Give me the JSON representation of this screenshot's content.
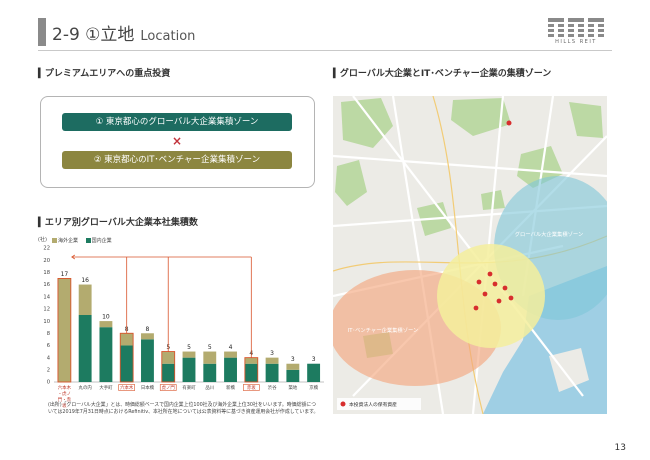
{
  "header": {
    "title": "2-9 ①立地",
    "title_en": "Location",
    "logo_text": "HILLS REIT"
  },
  "left": {
    "section_title": "プレミアムエリアへの重点投資",
    "zone_1": "① 東京都心のグローバル大企業集積ゾーン",
    "cross": "×",
    "zone_2": "② 東京都心のIT･ベンチャー企業集積ゾーン"
  },
  "chart_section_title": "エリア別グローバル大企業本社集積数",
  "chart_data": {
    "type": "bar",
    "unit": "(社)",
    "categories": [
      "六本木・虎ノ門・赤坂",
      "丸の内",
      "大手町",
      "六本木",
      "日本橋",
      "虎ノ門",
      "有楽町",
      "品川",
      "新橋",
      "赤坂",
      "渋谷",
      "築地",
      "京橋"
    ],
    "series": [
      {
        "name": "海外企業",
        "values": [
          17,
          5,
          1,
          2,
          1,
          2,
          1,
          2,
          1,
          1,
          1,
          1,
          0
        ],
        "color": "#b3ab6f"
      },
      {
        "name": "国内企業",
        "values": [
          0,
          11,
          9,
          6,
          7,
          3,
          4,
          3,
          4,
          3,
          3,
          2,
          3
        ],
        "color": "#1d7b60"
      }
    ],
    "totals": [
      17,
      16,
      10,
      8,
      8,
      5,
      5,
      5,
      4,
      4,
      3,
      3,
      3
    ],
    "highlighted": [
      "六本木・虎ノ門・赤坂",
      "六本木",
      "虎ノ門",
      "赤坂"
    ],
    "ylim": [
      0,
      22
    ],
    "yticks": [
      0,
      2,
      4,
      6,
      8,
      10,
      12,
      14,
      16,
      18,
      20,
      22
    ]
  },
  "source_note": "(出所)「グローバル大企業」とは、時価総額ベースで国内企業上位100社及び海外企業上位30社をいいます。時価総額については2019年7月31日時点におけるRefinitiv、本社所在地については公表資料等に基づき資産運用会社が作成しています。",
  "right": {
    "section_title": "グローバル大企業とIT･ベンチャー企業の集積ゾーン",
    "zone_global": "グローバル大企業集積ゾーン",
    "zone_it": "IT･ベンチャー企業集積ゾーン",
    "legend_label": "本投資法人の保有資産",
    "colors": {
      "global_zone": "#7fc7d9",
      "it_zone": "#f3a57a",
      "core_zone": "#f4ee9c",
      "asset_dot": "#d72e2e"
    }
  },
  "page_number": "13"
}
